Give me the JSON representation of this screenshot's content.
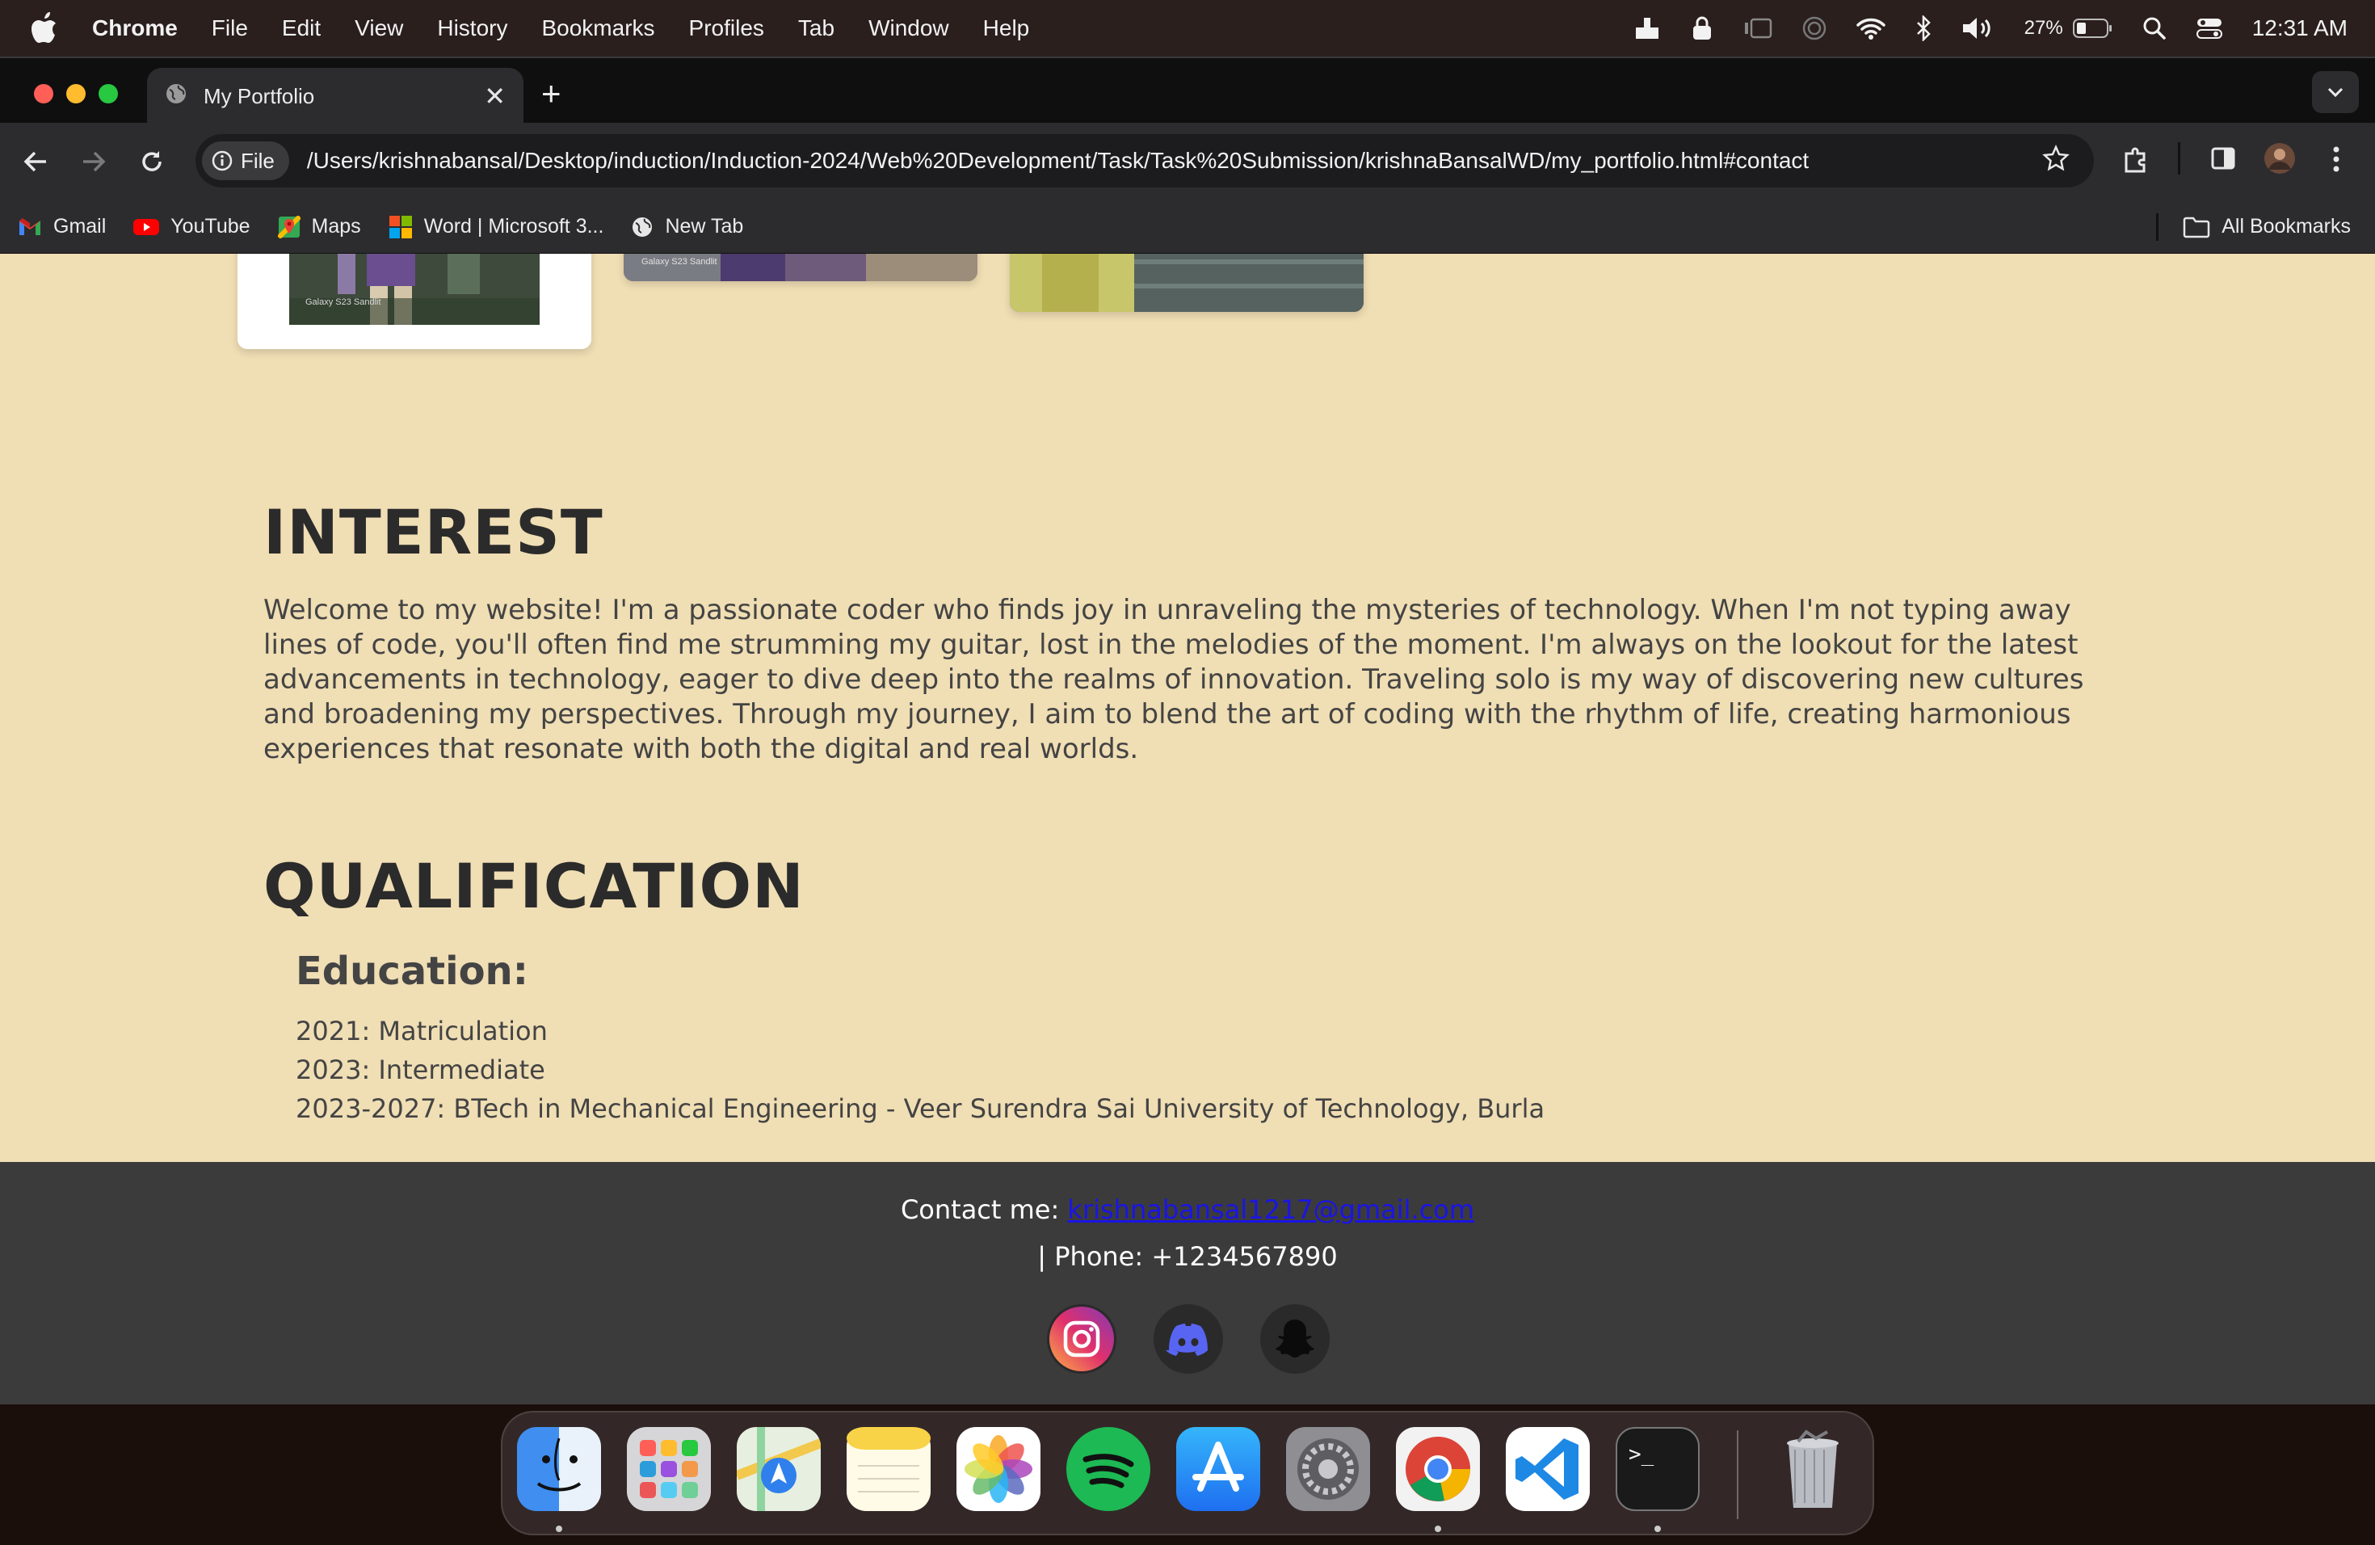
{
  "menubar": {
    "app_name": "Chrome",
    "items": [
      "File",
      "Edit",
      "View",
      "History",
      "Bookmarks",
      "Profiles",
      "Tab",
      "Window",
      "Help"
    ],
    "battery": "27%",
    "clock": "12:31 AM"
  },
  "browser": {
    "tab_title": "My Portfolio",
    "site_chip": "File",
    "url": "/Users/krishnabansal/Desktop/induction/Induction-2024/Web%20Development/Task/Task%20Submission/krishnaBansalWD/my_portfolio.html#contact",
    "bookmarks": [
      "Gmail",
      "YouTube",
      "Maps",
      "Word | Microsoft 3...",
      "New Tab"
    ],
    "all_bookmarks": "All Bookmarks"
  },
  "page": {
    "interest": {
      "title": "INTEREST",
      "text": "Welcome to my website! I'm a passionate coder who finds joy in unraveling the mysteries of technology. When I'm not typing away lines of code, you'll often find me strumming my guitar, lost in the melodies of the moment. I'm always on the lookout for the latest advancements in technology, eager to dive deep into the realms of innovation. Traveling solo is my way of discovering new cultures and broadening my perspectives. Through my journey, I aim to blend the art of coding with the rhythm of life, creating harmonious experiences that resonate with both the digital and real worlds."
    },
    "qualification": {
      "title": "QUALIFICATION",
      "education_title": "Education:",
      "items": [
        "2021: Matriculation",
        "2023: Intermediate",
        "2023-2027: BTech in Mechanical Engineering - Veer Surendra Sai University of Technology, Burla"
      ]
    },
    "photo_captions": [
      "Galaxy S23 Sandlit",
      "Galaxy S23 Sandlit"
    ],
    "footer": {
      "contact_label": "Contact me:",
      "email": "krishnabansal1217@gmail.com",
      "phone": "| Phone: +1234567890",
      "socials": [
        "instagram-icon",
        "discord-icon",
        "snapchat-icon"
      ]
    }
  },
  "dock": {
    "apps": [
      "Finder",
      "Launchpad",
      "Maps",
      "Notes",
      "Photos",
      "Spotify",
      "App Store",
      "System Settings",
      "Chrome",
      "Visual Studio Code",
      "Terminal",
      "Trash"
    ]
  },
  "colors": {
    "page_background": "#f0deb4",
    "footer_background": "#3b3b3c",
    "link": "#1a14e6",
    "heading": "#2b2b2b"
  }
}
